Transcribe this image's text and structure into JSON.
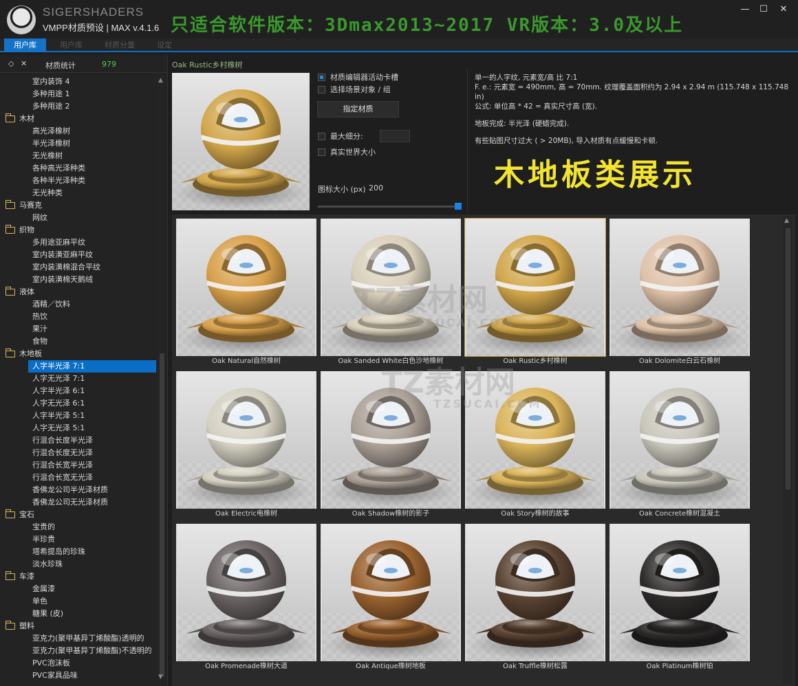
{
  "header": {
    "brand": "SIGERSHADERS",
    "subtitle": "VMPP材质预设 | MAX v.4.1.6",
    "banner": "只适合软件版本：3Dmax2013~2017  VR版本：3.0及以上",
    "minimize": "—",
    "maximize": "☐",
    "close": "✕"
  },
  "tabs": [
    {
      "label": "用户库"
    },
    {
      "label": "用户库"
    },
    {
      "label": "材质分量"
    },
    {
      "label": "设定"
    }
  ],
  "sidebar": {
    "tools_icon_1": "◇",
    "tools_icon_2": "✕",
    "stat_label": "材质统计",
    "stat_count": "979",
    "tree": [
      {
        "type": "item",
        "label": "室内装饰 4"
      },
      {
        "type": "item",
        "label": "多种用途 1"
      },
      {
        "type": "item",
        "label": "多种用途 2"
      },
      {
        "type": "cat",
        "label": "木材"
      },
      {
        "type": "item",
        "label": "高光泽橡树"
      },
      {
        "type": "item",
        "label": "半光泽橡树"
      },
      {
        "type": "item",
        "label": "无光橡树"
      },
      {
        "type": "item",
        "label": "各种高光泽种类"
      },
      {
        "type": "item",
        "label": "各种半光泽种类"
      },
      {
        "type": "item",
        "label": "无光种类"
      },
      {
        "type": "cat",
        "label": "马赛克"
      },
      {
        "type": "item",
        "label": "网纹"
      },
      {
        "type": "cat",
        "label": "织物"
      },
      {
        "type": "item",
        "label": "多用途亚麻平纹"
      },
      {
        "type": "item",
        "label": "室内装潢亚麻平纹"
      },
      {
        "type": "item",
        "label": "室内装潢棉混合平纹"
      },
      {
        "type": "item",
        "label": "室内装潢棉天鹅绒"
      },
      {
        "type": "cat",
        "label": "液体"
      },
      {
        "type": "item",
        "label": "酒精／饮料"
      },
      {
        "type": "item",
        "label": "热饮"
      },
      {
        "type": "item",
        "label": "果汁"
      },
      {
        "type": "item",
        "label": "食物"
      },
      {
        "type": "cat",
        "label": "木地板"
      },
      {
        "type": "item",
        "label": "人字半光泽 7:1",
        "selected": true
      },
      {
        "type": "item",
        "label": "人字无光泽 7:1"
      },
      {
        "type": "item",
        "label": "人字半光泽 6:1"
      },
      {
        "type": "item",
        "label": "人字无光泽 6:1"
      },
      {
        "type": "item",
        "label": "人字半光泽 5:1"
      },
      {
        "type": "item",
        "label": "人字无光泽 5:1"
      },
      {
        "type": "item",
        "label": "行混合长度半光泽"
      },
      {
        "type": "item",
        "label": "行混合长度无光泽"
      },
      {
        "type": "item",
        "label": "行混合长宽半光泽"
      },
      {
        "type": "item",
        "label": "行混合长宽无光泽"
      },
      {
        "type": "item",
        "label": "香佛龙公司半光泽材质"
      },
      {
        "type": "item",
        "label": "香佛龙公司无光泽材质"
      },
      {
        "type": "cat",
        "label": "宝石"
      },
      {
        "type": "item",
        "label": "宝贵的"
      },
      {
        "type": "item",
        "label": "半珍贵"
      },
      {
        "type": "item",
        "label": "塔希提岛的珍珠"
      },
      {
        "type": "item",
        "label": "淡水珍珠"
      },
      {
        "type": "cat",
        "label": "车漆"
      },
      {
        "type": "item",
        "label": "金属漆"
      },
      {
        "type": "item",
        "label": "单色"
      },
      {
        "type": "item",
        "label": "糖果 (皮)"
      },
      {
        "type": "cat",
        "label": "塑料"
      },
      {
        "type": "item",
        "label": "亚克力(聚甲基异丁烯酸酯)透明的"
      },
      {
        "type": "item",
        "label": "亚克力(聚甲基异丁烯酸酯)不透明的"
      },
      {
        "type": "item",
        "label": "PVC泡沫板"
      },
      {
        "type": "item",
        "label": "PVC家具品味"
      }
    ]
  },
  "detail": {
    "title": "Oak Rustic乡村橡树",
    "chk_active_slot": "材质编辑器活动卡槽",
    "chk_select_scene": "选择场景对象 / 组",
    "assign_button": "指定材质",
    "chk_max_subdiv": "最大细分:",
    "chk_real_world": "真实世界大小",
    "icon_size_label": "图标大小 (px)",
    "icon_size_value": "200",
    "icon_size_fraction": 0.98,
    "info": [
      "单一的人字纹, 元素宽/高 比 7:1",
      "F. e.: 元素宽 = 490mm, 高 = 70mm. 纹理覆盖面积约为 2.94 x 2.94 m (115.748 x 115.748 in)",
      "公式: 单位高 * 42 = 真实尺寸高 (宽).",
      "",
      "地板完成: 半光泽 (硬蜡完成).",
      "",
      "有些贴图尺寸过大 ( > 20MB), 导入材质有点缓慢和卡顿."
    ],
    "big_label": "木地板类展示"
  },
  "grid": {
    "materials": [
      {
        "label": "Oak Natural自然橡树",
        "color": "#d8a04a"
      },
      {
        "label": "Oak Sanded White白色沙地橡树",
        "color": "#d9d0bb"
      },
      {
        "label": "Oak Rustic乡村橡树",
        "color": "#d2a64a",
        "selected": true
      },
      {
        "label": "Oak Dolomite白云石橡树",
        "color": "#dfc2a8"
      },
      {
        "label": "Oak Electric电橡树",
        "color": "#d4d1c2"
      },
      {
        "label": "Oak Shadow橡树的影子",
        "color": "#aaa096"
      },
      {
        "label": "Oak Story橡树的故事",
        "color": "#dbb45a"
      },
      {
        "label": "Oak Concrete橡树混凝土",
        "color": "#c9c6bb"
      },
      {
        "label": "Oak Promenade橡树大道",
        "color": "#6a6463"
      },
      {
        "label": "Oak Antique橡树地板",
        "color": "#9a6230"
      },
      {
        "label": "Oak Truffle橡树松露",
        "color": "#5a4332"
      },
      {
        "label": "Oak Platinum橡树铂",
        "color": "#2e2c2b"
      }
    ]
  },
  "watermarks": {
    "main": "TZ素材网",
    "sub": "TZSUCAI.COM"
  }
}
